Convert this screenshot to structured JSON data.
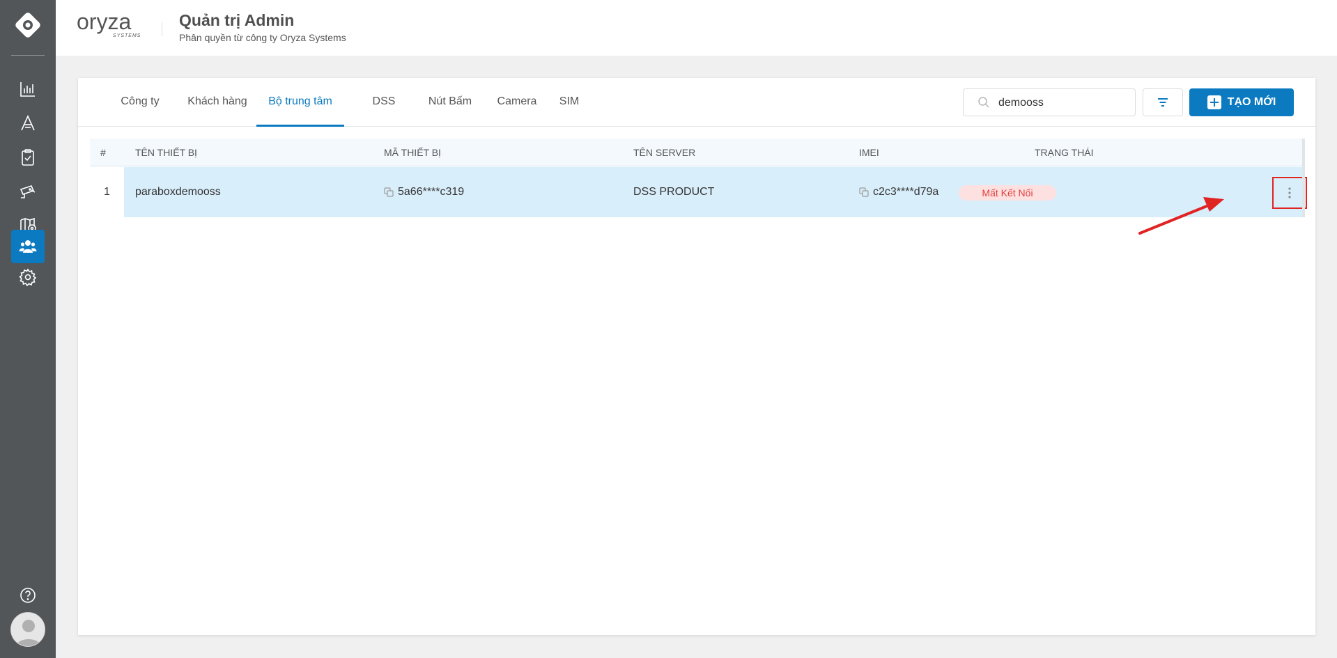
{
  "app": {
    "brand_main": "oryza",
    "brand_sub": "SYSTEMS",
    "title": "Quản trị Admin",
    "subtitle": "Phân quyền từ công ty Oryza Systems"
  },
  "sidebar": {
    "items": [
      {
        "icon": "bar-chart-icon"
      },
      {
        "icon": "font-icon"
      },
      {
        "icon": "clipboard-check-icon"
      },
      {
        "icon": "cctv-camera-icon"
      },
      {
        "icon": "map-pin-icon"
      },
      {
        "icon": "users-icon",
        "active": true
      },
      {
        "icon": "gear-icon"
      }
    ],
    "help_icon": "help-icon",
    "avatar_icon": "user-avatar-icon"
  },
  "tabs": [
    {
      "label": "Công ty"
    },
    {
      "label": "Khách hàng"
    },
    {
      "label": "Bộ trung tâm",
      "active": true
    },
    {
      "label": "DSS"
    },
    {
      "label": "Nút Bấm"
    },
    {
      "label": "Camera"
    },
    {
      "label": "SIM"
    }
  ],
  "search": {
    "value": "demooss"
  },
  "create_button": {
    "label": "TẠO MỚI"
  },
  "table": {
    "columns": [
      "#",
      "TÊN THIẾT BỊ",
      "MÃ THIẾT BỊ",
      "TÊN SERVER",
      "IMEI",
      "TRẠNG THÁI"
    ],
    "rows": [
      {
        "index": "1",
        "device_name": "paraboxdemooss",
        "device_code": "5a66****c319",
        "server": "DSS PRODUCT",
        "imei": "c2c3****d79a",
        "status": "Mất Kết Nối"
      }
    ]
  },
  "colors": {
    "accent": "#0b7ac1",
    "sidebar_bg": "#525659",
    "row_selected": "#d9eefb",
    "status_bg": "#fde0e0",
    "status_text": "#e0403e",
    "highlight": "#e02424"
  }
}
